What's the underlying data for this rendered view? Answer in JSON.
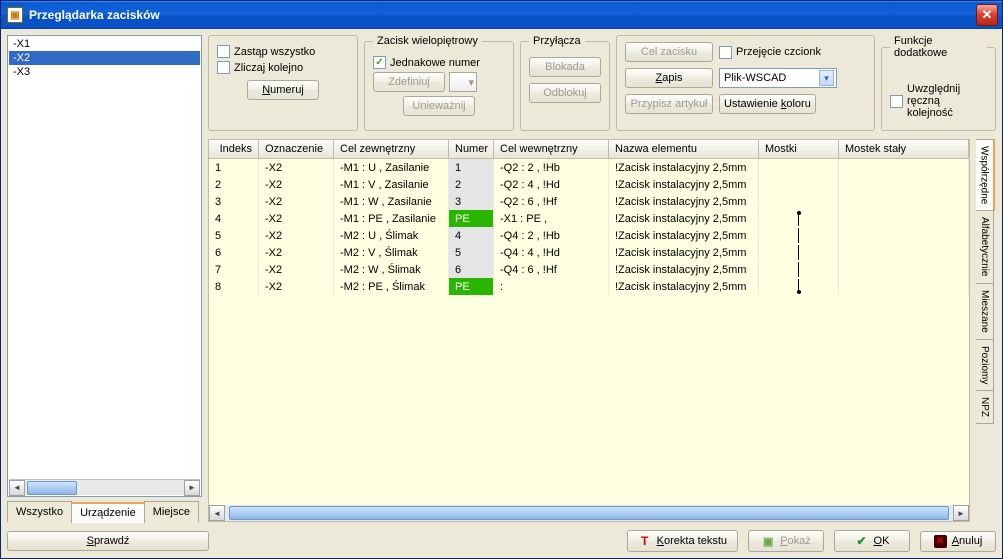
{
  "window": {
    "title": "Przeglądarka zacisków"
  },
  "left_list": {
    "items": [
      "-X1",
      "-X2",
      "-X3"
    ],
    "selected_index": 1
  },
  "left_tabs": [
    "Wszystko",
    "Urządzenie",
    "Miejsce"
  ],
  "left_tabs_active": 1,
  "fs1": {
    "replace_all": "Zastąp wszystko",
    "count_next": "Zliczaj kolejno",
    "numbering_btn": "Numeruj",
    "numbering_btn_u": "N"
  },
  "fs2": {
    "legend": "Zacisk wielopiętrowy",
    "same_numbers": "Jednakowe numer",
    "same_checked": true,
    "define_btn": "Zdefiniuj",
    "invalidate_btn": "Unieważnij"
  },
  "fs3": {
    "legend": "Przyłącza",
    "block_btn": "Blokada",
    "unblock_btn": "Odblokuj"
  },
  "fs4": {
    "goal_btn": "Cel zacisku",
    "font_inherit": "Przejęcie czcionk",
    "save_btn": "Zapis",
    "save_btn_u": "Z",
    "file_select": "Plik-WSCAD",
    "assign_article": "Przypisz artykuł",
    "color_settings": "Ustawienie koloru",
    "color_settings_u": "k"
  },
  "ext": {
    "legend": "Funkcje dodatkowe",
    "manual_order": "Uwzględnij ręczną kolejność"
  },
  "table": {
    "headers": [
      "Indeks",
      "Oznaczenie",
      "Cel zewnętrzny",
      "Numer",
      "Cel wewnętrzny",
      "Nazwa elementu",
      "Mostki",
      "Mostek stały"
    ],
    "rows": [
      {
        "idx": "1",
        "oz": "-X2",
        "cz": "-M1 : U , Zasilanie",
        "num": "1",
        "numCls": "num",
        "cw": "-Q2 : 2 , !Hb",
        "ne": "!Zacisk instalacyjny 2,5mm",
        "jp": ""
      },
      {
        "idx": "2",
        "oz": "-X2",
        "cz": "-M1 : V , Zasilanie",
        "num": "2",
        "numCls": "num",
        "cw": "-Q2 : 4 , !Hd",
        "ne": "!Zacisk instalacyjny 2,5mm",
        "jp": ""
      },
      {
        "idx": "3",
        "oz": "-X2",
        "cz": "-M1 : W , Zasilanie",
        "num": "3",
        "numCls": "num",
        "cw": "-Q2 : 6 , !Hf",
        "ne": "!Zacisk instalacyjny 2,5mm",
        "jp": ""
      },
      {
        "idx": "4",
        "oz": "-X2",
        "cz": "-M1 : PE , Zasilanie",
        "num": "PE",
        "numCls": "pe",
        "cw": "-X1 : PE ,",
        "ne": "!Zacisk instalacyjny 2,5mm",
        "jp": "top"
      },
      {
        "idx": "5",
        "oz": "-X2",
        "cz": "-M2 : U , Ślimak",
        "num": "4",
        "numCls": "num",
        "cw": "-Q4 : 2 , !Hb",
        "ne": "!Zacisk instalacyjny 2,5mm",
        "jp": "mid"
      },
      {
        "idx": "6",
        "oz": "-X2",
        "cz": "-M2 : V , Ślimak",
        "num": "5",
        "numCls": "num",
        "cw": "-Q4 : 4 , !Hd",
        "ne": "!Zacisk instalacyjny 2,5mm",
        "jp": "mid"
      },
      {
        "idx": "7",
        "oz": "-X2",
        "cz": "-M2 : W , Ślimak",
        "num": "6",
        "numCls": "num",
        "cw": "-Q4 : 6 , !Hf",
        "ne": "!Zacisk instalacyjny 2,5mm",
        "jp": "mid"
      },
      {
        "idx": "8",
        "oz": "-X2",
        "cz": "-M2 : PE , Ślimak",
        "num": "PE",
        "numCls": "pe",
        "cw": ":",
        "ne": "!Zacisk instalacyjny 2,5mm",
        "jp": "bot"
      }
    ]
  },
  "vtabs": [
    "Współrzędne",
    "Alfabetycznie",
    "Mieszane",
    "Poziomy",
    "NPZ"
  ],
  "footer": {
    "check_btn": "Sprawdź",
    "check_btn_u": "S",
    "text_corr": "Korekta tekstu",
    "text_corr_u": "K",
    "show": "Pokaż",
    "show_u": "P",
    "ok": "OK",
    "ok_u": "O",
    "cancel": "Anuluj",
    "cancel_u": "A"
  }
}
